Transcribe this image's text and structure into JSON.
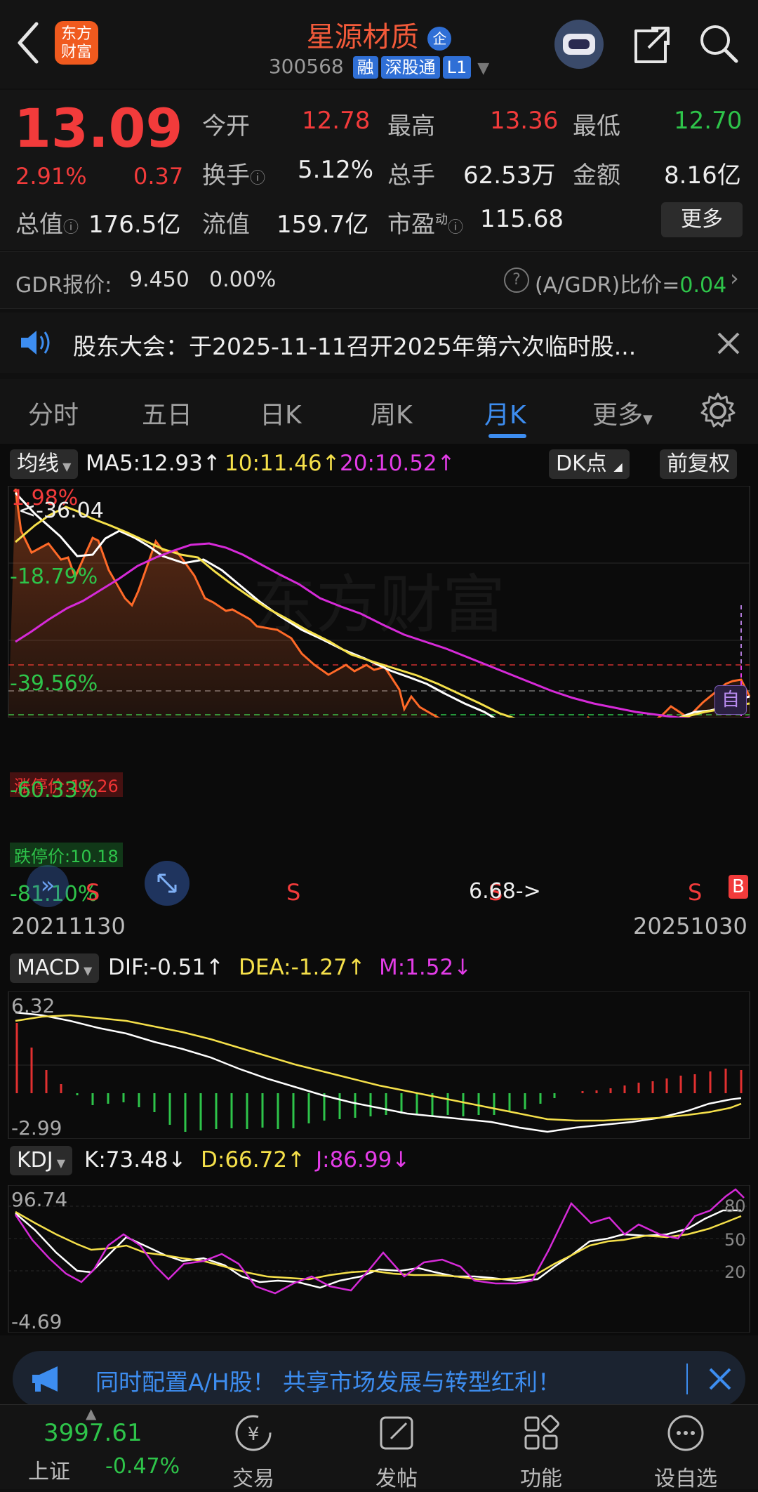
{
  "header": {
    "stock_name": "星源材质",
    "code": "300568",
    "badges": [
      "融",
      "深股通",
      "L1"
    ],
    "enterprise_badge": "企"
  },
  "quote": {
    "price": "13.09",
    "change_pct": "2.91%",
    "change": "0.37",
    "open_label": "今开",
    "open": "12.78",
    "high_label": "最高",
    "high": "13.36",
    "low_label": "最低",
    "low": "12.70",
    "turnover_label": "换手",
    "turnover": "5.12%",
    "volume_label": "总手",
    "volume": "62.53万",
    "amount_label": "金额",
    "amount": "8.16亿",
    "mktcap_label": "总值",
    "mktcap": "176.5亿",
    "float_label": "流值",
    "float": "159.7亿",
    "pe_label": "市盈",
    "pe_sup": "动",
    "pe": "115.68",
    "more_label": "更多"
  },
  "gdr": {
    "label": "GDR报价:",
    "price": "9.450",
    "change": "0.00%",
    "ratio_label": "(A/GDR)比价=",
    "ratio": "0.04"
  },
  "notice": {
    "text": "股东大会：于2025-11-11召开2025年第六次临时股..."
  },
  "tabs": [
    "分时",
    "五日",
    "日K",
    "周K",
    "月K",
    "更多"
  ],
  "active_tab": "月K",
  "kline": {
    "indicator_label": "均线",
    "ma5": "MA5:12.93",
    "ma10": "10:11.46",
    "ma20": "20:10.52",
    "dk_label": "DK点",
    "adjust_label": "前复权",
    "top_pct": "1.98%",
    "max_label": "<-36.04",
    "pct_levels": [
      "-18.79%",
      "-39.56%",
      "-60.33%",
      "-81.10%"
    ],
    "limit_up": "涨停价:15.26",
    "limit_down": "跌停价:10.18",
    "min_label": "6.68->",
    "sell_markers": [
      "S",
      "S",
      "S",
      "S"
    ],
    "buy_marker": "B",
    "self_marker": "自",
    "date_start": "20211130",
    "date_end": "20251030",
    "watermark": "东方财富"
  },
  "macd": {
    "label": "MACD",
    "dif": "DIF:-0.51",
    "dea": "DEA:-1.27",
    "m": "M:1.52",
    "max": "6.32",
    "min": "-2.99"
  },
  "kdj": {
    "label": "KDJ",
    "k": "K:73.48",
    "d": "D:66.72",
    "j": "J:86.99",
    "max": "96.74",
    "min": "-4.69",
    "levels": [
      "80",
      "50",
      "20"
    ]
  },
  "banner": {
    "text": "同时配置A/H股！ 共享市场发展与转型红利！"
  },
  "bottom_nav": {
    "index_value": "3997.61",
    "index_name": "上证",
    "index_change": "-0.47%",
    "items": [
      "交易",
      "发帖",
      "功能",
      "设自选"
    ]
  },
  "colors": {
    "up": "#f23b3b",
    "down": "#2ec44a",
    "accent": "#3d8df0",
    "ma5": "#ffffff",
    "ma10": "#f5e04a",
    "ma20": "#d62ad8",
    "kline": "#ff6a28"
  },
  "icons": [
    "back-arrow-icon",
    "robot-avatar-icon",
    "share-icon",
    "search-icon",
    "speaker-icon",
    "close-icon",
    "settings-gear-icon",
    "help-circle-icon",
    "chevron-right-icon",
    "expand-icon",
    "double-chevron-icon",
    "megaphone-icon",
    "trade-yen-icon",
    "post-edit-icon",
    "function-grid-icon",
    "more-dots-icon"
  ]
}
